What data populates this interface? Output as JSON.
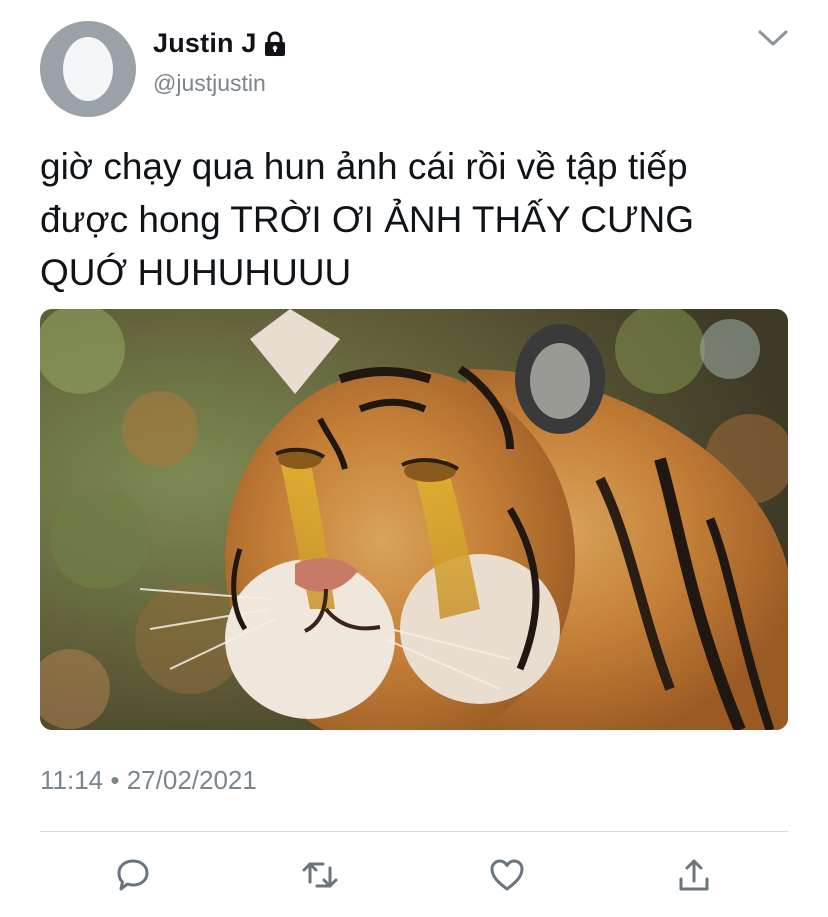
{
  "user": {
    "display_name": "Justin J",
    "handle": "@justjustin"
  },
  "tweet": {
    "text": "giờ chạy qua hun ảnh cái rồi về tập tiếp\nđược hong TRỜI ƠI ẢNH THẤY CƯNG\nQUỚ HUHUHUUU",
    "time": "11:14",
    "separator": "•",
    "date": "27/02/2021"
  },
  "media": {
    "subject": "crying tiger meme"
  },
  "icons": [
    "lock-icon",
    "chevron-down-icon",
    "reply-icon",
    "retweet-icon",
    "like-icon",
    "share-icon"
  ],
  "colors": {
    "text": "#0f1419",
    "secondary": "#7b858e",
    "icon": "#6b747c",
    "divider": "#d6dadf"
  }
}
